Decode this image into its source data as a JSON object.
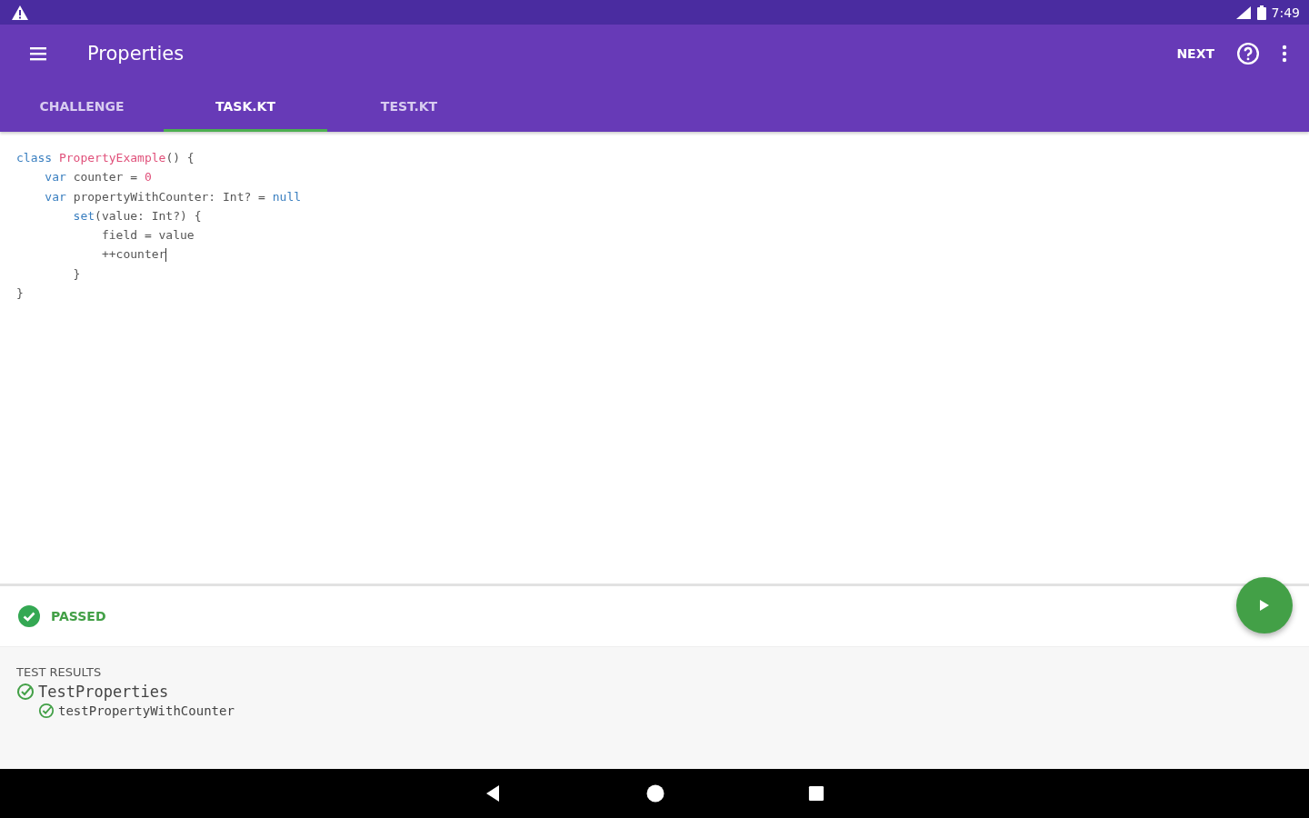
{
  "status_bar": {
    "time": "7:49"
  },
  "toolbar": {
    "title": "Properties",
    "action": "NEXT"
  },
  "tabs": [
    {
      "label": "CHALLENGE",
      "selected": false
    },
    {
      "label": "TASK.KT",
      "selected": true
    },
    {
      "label": "TEST.KT",
      "selected": false
    }
  ],
  "code": [
    [
      {
        "text": "class ",
        "kind": "keyword"
      },
      {
        "text": "PropertyExample",
        "kind": "type"
      },
      {
        "text": "() {",
        "kind": "plain"
      }
    ],
    [
      {
        "text": "    var ",
        "kind": "keyword"
      },
      {
        "text": "counter = ",
        "kind": "plain"
      },
      {
        "text": "0",
        "kind": "number"
      }
    ],
    [
      {
        "text": "    var ",
        "kind": "keyword"
      },
      {
        "text": "propertyWithCounter: Int? = ",
        "kind": "plain"
      },
      {
        "text": "null",
        "kind": "keyword"
      }
    ],
    [
      {
        "text": "        set",
        "kind": "keyword"
      },
      {
        "text": "(value: Int?) {",
        "kind": "plain"
      }
    ],
    [
      {
        "text": "            field = value",
        "kind": "plain"
      }
    ],
    [
      {
        "text": "            ++counter",
        "kind": "plain",
        "cursor": true
      }
    ],
    [
      {
        "text": "        }",
        "kind": "plain"
      }
    ],
    [
      {
        "text": "}",
        "kind": "plain"
      }
    ]
  ],
  "result": {
    "status": "PASSED",
    "passed": true
  },
  "test_results": {
    "heading": "TEST RESULTS",
    "tests": [
      {
        "name": "TestProperties",
        "passed": true,
        "children": [
          {
            "name": "testPropertyWithCounter",
            "passed": true
          }
        ]
      }
    ]
  }
}
